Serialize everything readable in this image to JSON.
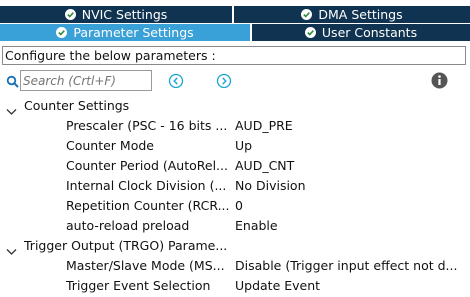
{
  "tabs_row1": [
    {
      "label": "NVIC Settings",
      "icon": "check-circle-icon"
    },
    {
      "label": "DMA Settings",
      "icon": "check-circle-icon"
    }
  ],
  "tabs_row2": [
    {
      "label": "Parameter Settings",
      "icon": "check-circle-icon",
      "active": true
    },
    {
      "label": "User Constants",
      "icon": "check-circle-icon",
      "active": false
    }
  ],
  "header_text": "Configure the below parameters :",
  "search": {
    "placeholder": "Search (Crtl+F)"
  },
  "tree": {
    "counter_settings": {
      "title": "Counter Settings",
      "params": [
        {
          "label": "Prescaler (PSC - 16 bits ...",
          "value": "AUD_PRE"
        },
        {
          "label": "Counter Mode",
          "value": "Up"
        },
        {
          "label": "Counter Period (AutoRel...",
          "value": "AUD_CNT"
        },
        {
          "label": "Internal Clock Division (...",
          "value": "No Division"
        },
        {
          "label": "Repetition Counter (RCR...",
          "value": "0"
        },
        {
          "label": "auto-reload preload",
          "value": "Enable"
        }
      ]
    },
    "trigger_output": {
      "title": "Trigger Output (TRGO) Parame...",
      "params": [
        {
          "label": "Master/Slave Mode (MS...",
          "value": "Disable (Trigger input effect not d..."
        },
        {
          "label": "Trigger Event Selection",
          "value": "Update Event"
        }
      ]
    }
  },
  "colors": {
    "tab_dark": "#0f3350",
    "tab_active": "#3aa0d8",
    "check_green": "#2e8b3a",
    "nav_cyan": "#1aa3d6"
  }
}
